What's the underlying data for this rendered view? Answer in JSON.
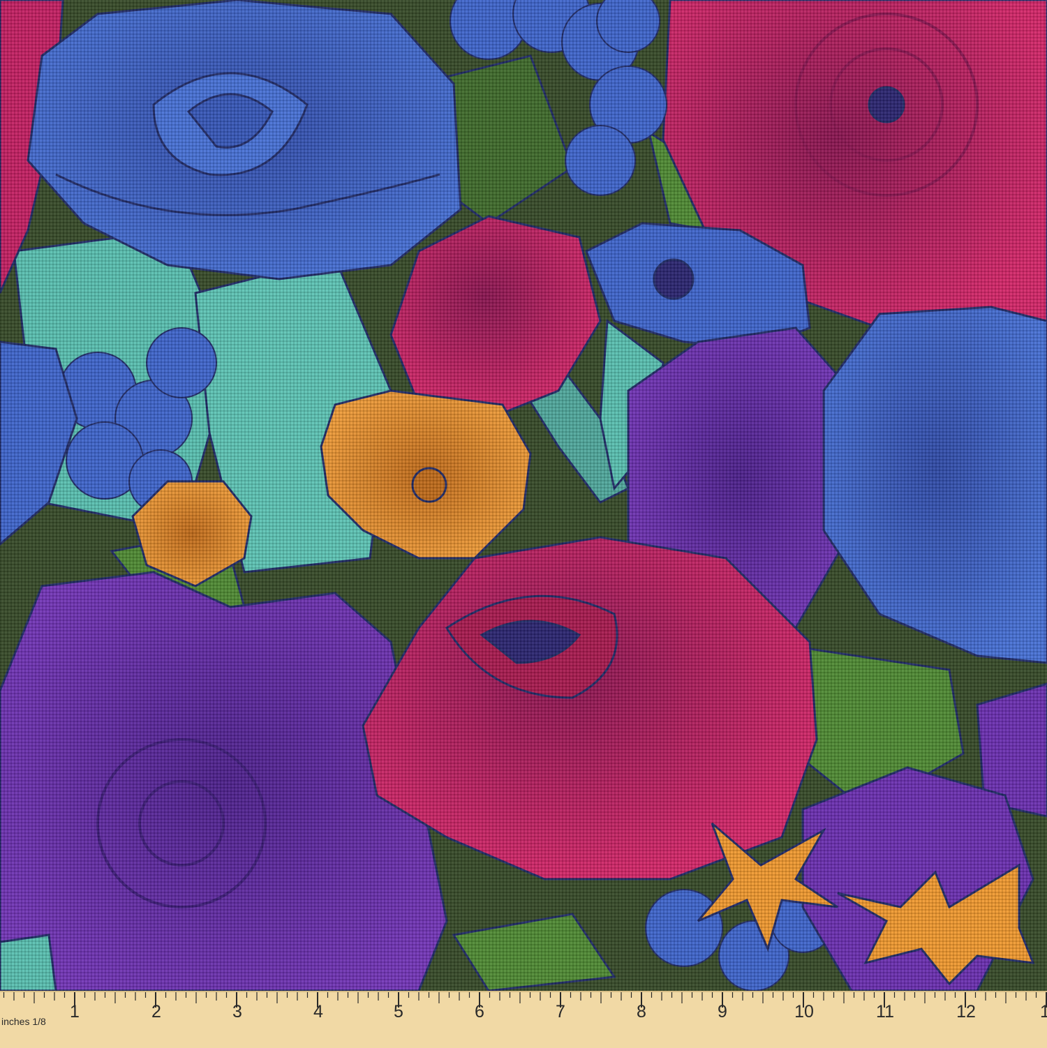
{
  "image": {
    "subject": "floral fabric swatch with measuring ruler",
    "colors": {
      "background": "#364a28",
      "blue": "#3d64cc",
      "magenta": "#c41e62",
      "purple": "#6a2eb0",
      "orange": "#f0982e",
      "teal": "#58c0b0",
      "green": "#4e8a32",
      "outline": "#1f2a66"
    }
  },
  "ruler": {
    "units_label": "inches 1/8",
    "numbers": [
      "1",
      "2",
      "3",
      "4",
      "5",
      "6",
      "7",
      "8",
      "9",
      "10",
      "11",
      "12",
      "1"
    ]
  }
}
